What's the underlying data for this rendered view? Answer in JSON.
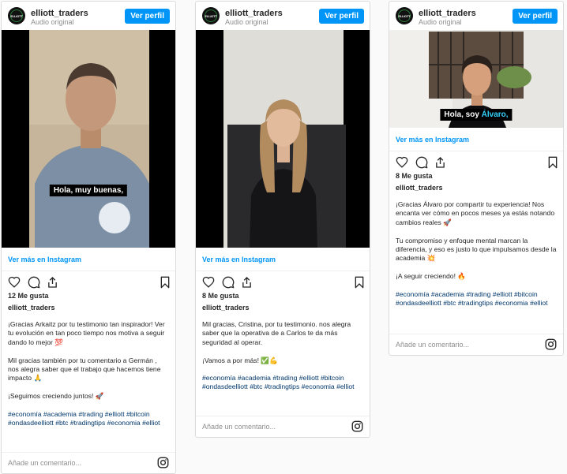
{
  "posts": [
    {
      "username": "elliott_traders",
      "audio": "Audio original",
      "profile_button": "Ver perfil",
      "avatar_text": "ELLIOTT",
      "video_caption": "Hola, muy buenas,",
      "see_more": "Ver más en Instagram",
      "likes": "12 Me gusta",
      "author": "elliott_traders",
      "text": "¡Gracias Arkaitz por tu testimonio tan inspirador! Ver tu evolución en tan poco tiempo nos motiva a seguir dando lo mejor 💯\n\nMil gracias también por tu comentario a Germán , nos alegra saber que el trabajo que hacemos tiene impacto 🙏\n\n¡Seguimos creciendo juntos! 🚀",
      "hashtags": "#economía #academia #trading #elliott #bitcoin #ondasdeelliott #btc #tradingtips #economia #elliot",
      "comment_placeholder": "Añade un comentario..."
    },
    {
      "username": "elliott_traders",
      "audio": "Audio original",
      "profile_button": "Ver perfil",
      "avatar_text": "ELLIOTT",
      "video_caption": "",
      "see_more": "Ver más en Instagram",
      "likes": "8 Me gusta",
      "author": "elliott_traders",
      "text": "Mil gracias, Cristina, por tu testimonio. nos alegra saber que la operativa de a Carlos te da más seguridad al operar.\n\n¡Vamos a por más! ✅💪",
      "hashtags": "#economía #academia #trading #elliott #bitcoin #ondasdeelliott #btc #tradingtips #economia #elliot",
      "comment_placeholder": "Añade un comentario..."
    },
    {
      "username": "elliott_traders",
      "audio": "Audio original",
      "profile_button": "Ver perfil",
      "avatar_text": "ELLIOTT",
      "video_caption_a": "Hola, soy ",
      "video_caption_b": "Álvaro,",
      "see_more": "Ver más en Instagram",
      "likes": "8 Me gusta",
      "author": "elliott_traders",
      "text": "¡Gracias Álvaro por compartir tu experiencia! Nos encanta ver cómo en pocos meses ya estás notando cambios reales 🚀\n\nTu compromiso y enfoque mental marcan la diferencia, y eso es justo lo que impulsamos desde la academia 💥\n\n¡A seguir creciendo! 🔥",
      "hashtags": "#economía #academia #trading #elliott #bitcoin #ondasdeelliott #btc #tradingtips #economia #elliot",
      "comment_placeholder": "Añade un comentario..."
    }
  ],
  "colors": {
    "accent": "#0095f6",
    "caption_highlight": "#35d5ff"
  }
}
